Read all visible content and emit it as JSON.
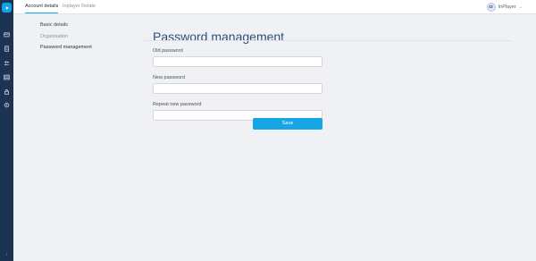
{
  "topbar": {
    "tabs": [
      {
        "label": "Account details",
        "active": true
      },
      {
        "label": "Inplayer Relate",
        "active": false
      }
    ],
    "user": {
      "name": "InPlayer",
      "icon": "avatar-icon",
      "dropdown_icon": "chevron-down-icon"
    }
  },
  "sidebar": {
    "logo_icon": "play-logo-icon",
    "icons": [
      "wallet-icon",
      "document-icon",
      "users-icon",
      "grid-icon",
      "lock-icon",
      "settings-icon"
    ],
    "collapse_icon": "chevron-left-icon"
  },
  "subnav": {
    "items": [
      {
        "label": "Basic details",
        "state": "default"
      },
      {
        "label": "Organisation",
        "state": "muted"
      },
      {
        "label": "Password management",
        "state": "current"
      }
    ]
  },
  "main": {
    "title": "Password management",
    "fields": [
      {
        "label": "Old password",
        "value": "",
        "placeholder": ""
      },
      {
        "label": "New password",
        "value": "",
        "placeholder": ""
      },
      {
        "label": "Repeat new password",
        "value": "",
        "placeholder": ""
      }
    ],
    "save_label": "Save"
  },
  "colors": {
    "rail": "#1d3354",
    "accent": "#16a6e6",
    "title": "#2c4f7c",
    "background": "#eff1f4"
  }
}
